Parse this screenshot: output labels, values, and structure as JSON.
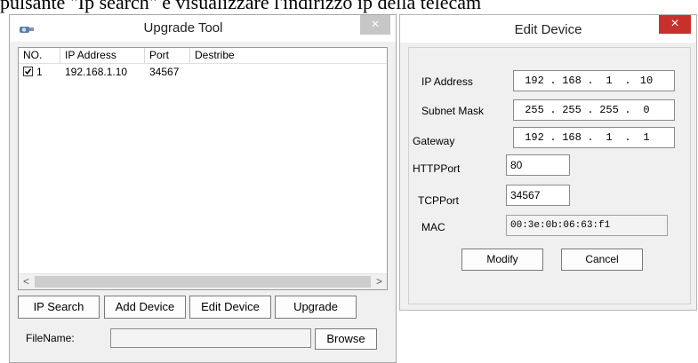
{
  "caption": "pulsante \"Ip search\" e visualizzare l'indirizzo ip della telecam",
  "upgrade_tool": {
    "title": "Upgrade Tool",
    "app_icon": "camera-icon",
    "close_glyph": "×",
    "list": {
      "columns": [
        "NO.",
        "IP Address",
        "Port",
        "Destribe"
      ],
      "rows": [
        {
          "no": "1",
          "ip": "192.168.1.10",
          "port": "34567",
          "describe": "",
          "checked": true
        }
      ]
    },
    "scroll_left": "<",
    "scroll_right": ">",
    "buttons": {
      "ip_search": "IP Search",
      "add_device": "Add Device",
      "edit_device": "Edit Device",
      "upgrade": "Upgrade"
    },
    "filename_label": "FileName:",
    "filename_value": "",
    "browse": "Browse"
  },
  "edit_device": {
    "title": "Edit Device",
    "close_glyph": "×",
    "ip_label": "IP Address",
    "ip": [
      "192",
      "168",
      "1",
      "10"
    ],
    "subnet_label": "Subnet Mask",
    "subnet": [
      "255",
      "255",
      "255",
      "0"
    ],
    "gateway_label": "Gateway",
    "gateway": [
      "192",
      "168",
      "1",
      "1"
    ],
    "http_label": "HTTPPort",
    "http_value": "80",
    "tcp_label": "TCPPort",
    "tcp_value": "34567",
    "mac_label": "MAC",
    "mac_value": "00:3e:0b:06:63:f1",
    "modify": "Modify",
    "cancel": "Cancel"
  },
  "colors": {
    "close_active": "#c9302c",
    "close_inactive": "#c7c7c7",
    "window_bg": "#f0f0f0"
  }
}
